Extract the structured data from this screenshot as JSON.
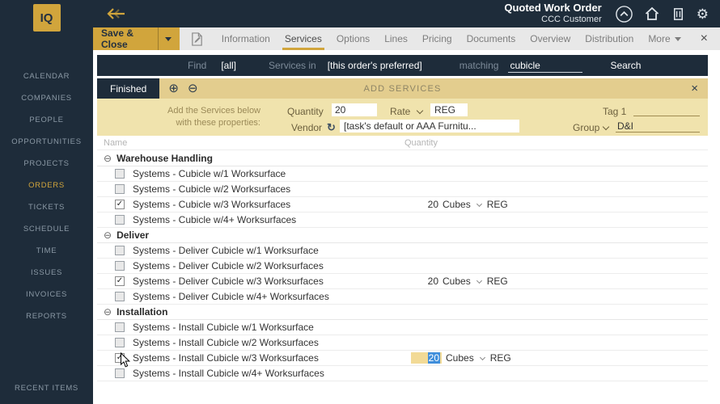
{
  "brand": {
    "logo_text": "IQ"
  },
  "sidebar": {
    "items": [
      "CALENDAR",
      "COMPANIES",
      "PEOPLE",
      "OPPORTUNITIES",
      "PROJECTS",
      "ORDERS",
      "TICKETS",
      "SCHEDULE",
      "TIME",
      "ISSUES",
      "INVOICES",
      "REPORTS"
    ],
    "active_item": "ORDERS",
    "recent_label": "RECENT ITEMS"
  },
  "header": {
    "title": "Quoted Work Order",
    "subtitle": "CCC Customer"
  },
  "toolbar": {
    "save_button": "Save & Close",
    "tabs": [
      "Information",
      "Services",
      "Options",
      "Lines",
      "Pricing",
      "Documents",
      "Overview",
      "Distribution"
    ],
    "active_tab": "Services",
    "more_label": "More"
  },
  "search_bar": {
    "find_label": "Find",
    "scope_value": "[all]",
    "services_in_label": "Services in",
    "source_value": "[this order's preferred]",
    "matching_label": "matching",
    "matching_value": "cubicle",
    "search_button": "Search"
  },
  "add_services_bar": {
    "finished_button": "Finished",
    "title": "ADD SERVICES"
  },
  "properties": {
    "intro_line1": "Add the Services below",
    "intro_line2": "with these properties:",
    "quantity_label": "Quantity",
    "quantity_value": "20",
    "rate_label": "Rate",
    "rate_value": "REG",
    "tag_label": "Tag 1",
    "tag_value": "",
    "vendor_label": "Vendor",
    "vendor_value": "[task's default or AAA Furnitu...",
    "group_label": "Group",
    "group_value": "D&I"
  },
  "table": {
    "name_column": "Name",
    "quantity_column": "Quantity",
    "groups": [
      {
        "name": "Warehouse Handling",
        "rows": [
          {
            "label": "Systems - Cubicle w/1 Worksurface",
            "checked": false
          },
          {
            "label": "Systems - Cubicle w/2 Worksurfaces",
            "checked": false
          },
          {
            "label": "Systems - Cubicle w/3 Worksurfaces",
            "checked": true,
            "quantity": "20",
            "unit": "Cubes",
            "rate": "REG"
          },
          {
            "label": "Systems - Cubicle w/4+ Worksurfaces",
            "checked": false
          }
        ]
      },
      {
        "name": "Deliver",
        "rows": [
          {
            "label": "Systems - Deliver Cubicle w/1 Worksurface",
            "checked": false
          },
          {
            "label": "Systems - Deliver Cubicle w/2 Worksurfaces",
            "checked": false
          },
          {
            "label": "Systems - Deliver Cubicle w/3 Worksurfaces",
            "checked": true,
            "quantity": "20",
            "unit": "Cubes",
            "rate": "REG"
          },
          {
            "label": "Systems - Deliver Cubicle w/4+ Worksurfaces",
            "checked": false
          }
        ]
      },
      {
        "name": "Installation",
        "rows": [
          {
            "label": "Systems - Install Cubicle w/1 Worksurface",
            "checked": false
          },
          {
            "label": "Systems - Install Cubicle w/2 Worksurfaces",
            "checked": false
          },
          {
            "label": "Systems - Install Cubicle w/3 Worksurfaces",
            "checked": true,
            "quantity": "20",
            "unit": "Cubes",
            "rate": "REG",
            "editing": true
          },
          {
            "label": "Systems - Install Cubicle w/4+ Worksurfaces",
            "checked": false
          }
        ]
      }
    ]
  },
  "icons": {
    "back_arrow": "double-chevron-left",
    "collapse_header": "circle-chevron-up",
    "home": "house",
    "company": "building",
    "gear": "⚙",
    "document": "page-pencil",
    "close": "×",
    "plus_circle": "⊕",
    "minus_circle": "⊖",
    "check": "✓",
    "refresh": "↻",
    "chevron_down": "v-shape"
  },
  "colors": {
    "navy": "#1e2c3a",
    "gold": "#d1a53c",
    "tan_bar": "#e3cd8e",
    "tan_panel": "#f0e3ad",
    "selection_blue": "#3f8edb"
  }
}
